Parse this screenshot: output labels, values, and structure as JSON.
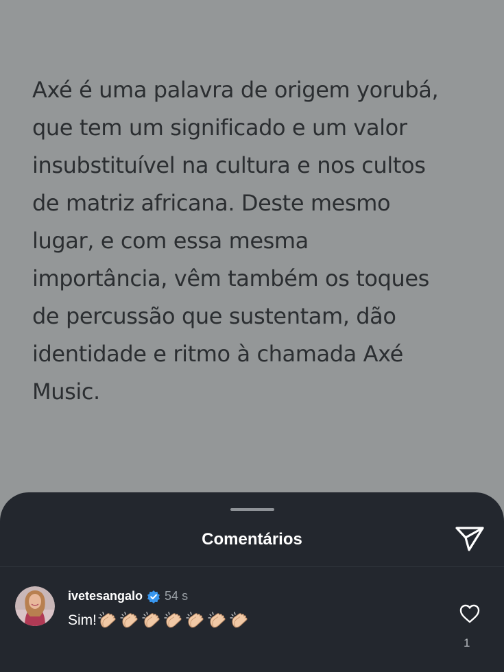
{
  "post": {
    "lines": [
      "Axé é uma palavra de origem yorubá,",
      "que tem um significado e um valor",
      "insubstituível na cultura e nos cultos",
      "de matriz africana. Deste mesmo",
      "lugar, e com essa mesma",
      "importância, vêm também os toques",
      "de percussão que sustentam, dão",
      "identidade e ritmo à chamada Axé",
      "Music."
    ]
  },
  "comments_sheet": {
    "title": "Comentários",
    "share_icon": "send-icon",
    "comment": {
      "username": "ivetesangalo",
      "verified_icon": "verified-badge-icon",
      "time": "54 s",
      "text": "Sim!",
      "emoji_count": 7,
      "emoji_icon": "clapping-hands-icon",
      "like_icon": "heart-outline-icon",
      "like_count": "1"
    }
  },
  "colors": {
    "post_background": "#949798",
    "post_text": "#2b2e31",
    "sheet_background": "#23272e",
    "verified_blue": "#3897f0"
  }
}
